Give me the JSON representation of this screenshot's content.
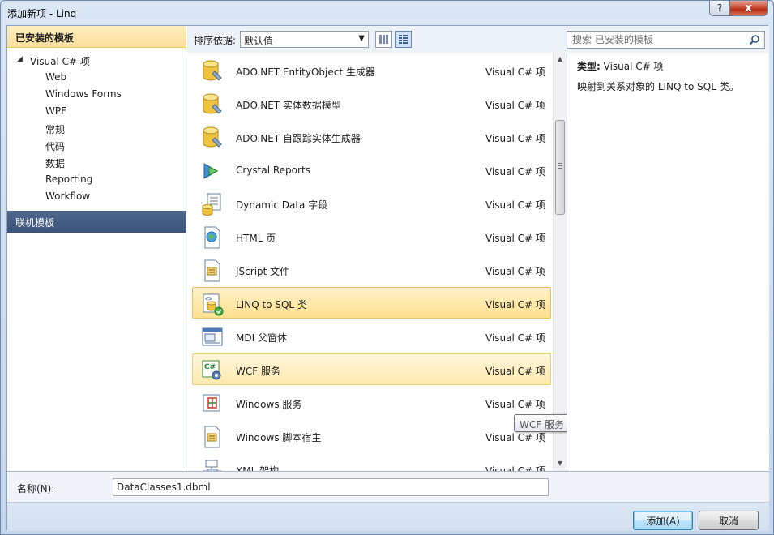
{
  "window": {
    "title": "添加新项 - Linq",
    "help_label": "?",
    "close_label": "x"
  },
  "left": {
    "installed_header": "已安装的模板",
    "tree_root": "Visual C# 项",
    "tree_items": [
      "Web",
      "Windows Forms",
      "WPF",
      "常规",
      "代码",
      "数据",
      "Reporting",
      "Workflow"
    ],
    "online_header": "联机模板"
  },
  "toolbar": {
    "sort_label": "排序依据:",
    "sort_value": "默认值",
    "search_placeholder": "搜索 已安装的模板"
  },
  "templates": [
    {
      "name": "ADO.NET EntityObject 生成器",
      "lang": "Visual C# 项",
      "icon": "database-icon"
    },
    {
      "name": "ADO.NET 实体数据模型",
      "lang": "Visual C# 项",
      "icon": "database-icon"
    },
    {
      "name": "ADO.NET 自跟踪实体生成器",
      "lang": "Visual C# 项",
      "icon": "database-icon"
    },
    {
      "name": "Crystal Reports",
      "lang": "Visual C# 项",
      "icon": "crystal-reports-icon"
    },
    {
      "name": "Dynamic Data 字段",
      "lang": "Visual C# 项",
      "icon": "dynamic-data-icon"
    },
    {
      "name": "HTML 页",
      "lang": "Visual C# 项",
      "icon": "html-page-icon"
    },
    {
      "name": "JScript 文件",
      "lang": "Visual C# 项",
      "icon": "script-file-icon"
    },
    {
      "name": "LINQ to SQL 类",
      "lang": "Visual C# 项",
      "icon": "linq-to-sql-icon"
    },
    {
      "name": "MDI 父窗体",
      "lang": "Visual C# 项",
      "icon": "mdi-form-icon"
    },
    {
      "name": "WCF 服务",
      "lang": "Visual C# 项",
      "icon": "wcf-service-icon"
    },
    {
      "name": "Windows 服务",
      "lang": "Visual C# 项",
      "icon": "windows-service-icon"
    },
    {
      "name": "Windows 脚本宿主",
      "lang": "Visual C# 项",
      "icon": "script-file-icon"
    },
    {
      "name": "XML 架构",
      "lang": "Visual C# 项",
      "icon": "xml-schema-icon"
    }
  ],
  "selected_index": 7,
  "hover_index": 9,
  "tooltip": "WCF 服务",
  "description": {
    "type_label": "类型:",
    "type_value": "Visual C# 项",
    "text": "映射到关系对象的 LINQ to SQL 类。"
  },
  "bottom": {
    "name_label": "名称(N):",
    "name_value": "DataClasses1.dbml",
    "add_label": "添加(A)",
    "cancel_label": "取消"
  },
  "colors": {
    "selected_bg": "#ffe08e",
    "online_header_bg": "#3b5479",
    "installed_header_bg": "#fbe09a"
  }
}
